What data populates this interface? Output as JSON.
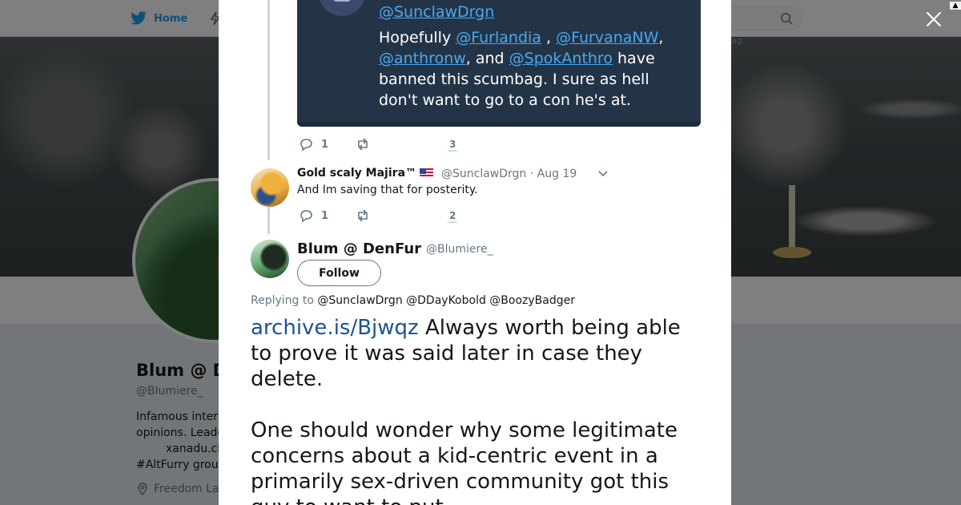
{
  "nav": {
    "home_label": "Home"
  },
  "profile": {
    "name": "Blum @ D",
    "handle": "@Blumiere_",
    "bio_lines": [
      "Infamous inter",
      "opinions. Leade",
      "xanadu.cl",
      "#AltFurry grou"
    ],
    "location": "Freedom La",
    "hashtag_peek": "ag"
  },
  "quoted_card": {
    "handle": "@SunclawDrgn",
    "text_parts": [
      "Hopefully ",
      "@Furlandia",
      " , ",
      "@FurvanaNW",
      ",",
      "@anthronw",
      ", and ",
      "@SpokAnthro",
      " have banned this scumbag. I sure as hell don't want to go to a con he's at."
    ]
  },
  "first_actions": {
    "replies": "1",
    "likes": "3"
  },
  "reply_tweet": {
    "name": "Gold scaly Majira™",
    "handle": "@SunclawDrgn",
    "date": "· Aug 19",
    "text": "And Im saving that for posterity.",
    "replies": "1",
    "likes": "2"
  },
  "main_tweet": {
    "name": "Blum @ DenFur",
    "handle": "@Blumiere_",
    "follow_label": "Follow",
    "replying_prefix": "Replying to ",
    "replying_to": "@SunclawDrgn @DDayKobold @BoozyBadger",
    "link": "archive.is/Bjwqz",
    "text_1": " Always worth being able to prove it was said later in case they delete.",
    "text_2": "One should wonder why some legitimate concerns about a kid-centric event in a primarily sex-driven community got this guy to want to put"
  },
  "colors": {
    "accent": "#1da1f2",
    "card_bg": "#243447",
    "link": "#1b5391"
  }
}
